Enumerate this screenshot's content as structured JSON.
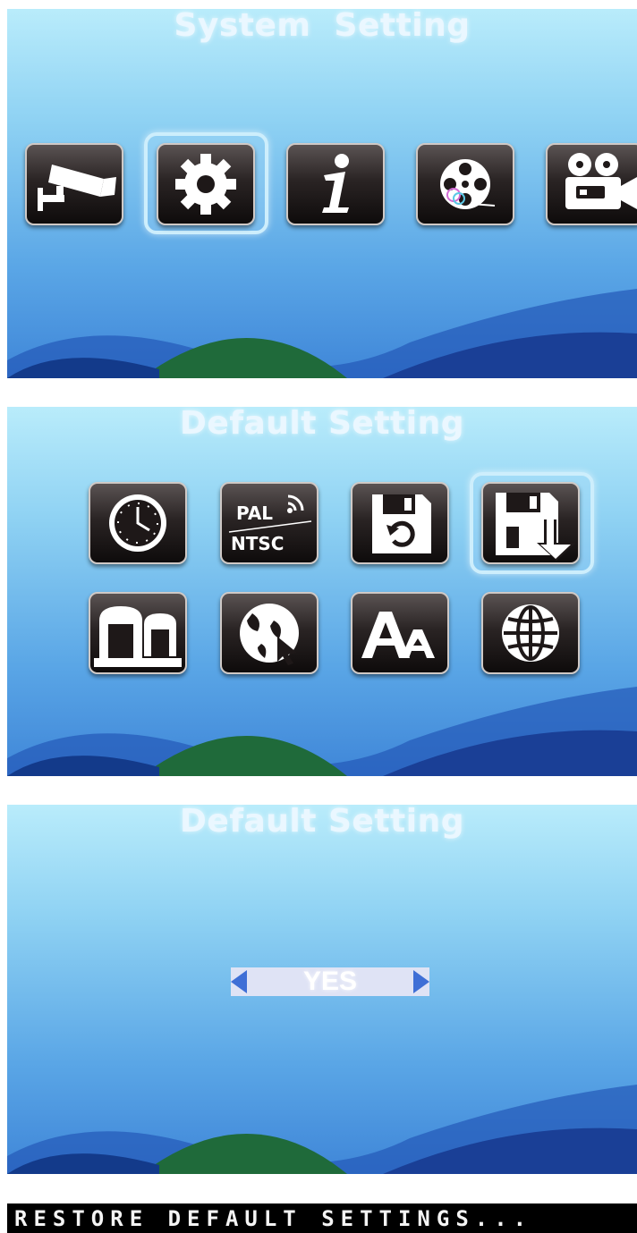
{
  "screens": [
    {
      "title": "System  Setting",
      "menu": [
        "camera-icon",
        "gear-icon",
        "info-icon",
        "film-reel-icon",
        "video-camera-icon"
      ],
      "selected": "gear-icon"
    },
    {
      "title": "Default Setting",
      "menu": [
        "clock-icon",
        "pal-ntsc-icon",
        "floppy-restore-icon",
        "floppy-download-icon",
        "archive-icon",
        "globe-cursor-icon",
        "font-size-icon",
        "globe-icon"
      ],
      "selected": "floppy-download-icon",
      "pal_label": "PAL",
      "ntsc_label": "NTSC"
    },
    {
      "title": "Default Setting",
      "option_value": "YES"
    }
  ],
  "status_banner": "RESTORE DEFAULT SETTINGS...",
  "colors": {
    "accent": "#3f6fd6",
    "tile": "#1a1515",
    "selection": "#cdeefc"
  }
}
